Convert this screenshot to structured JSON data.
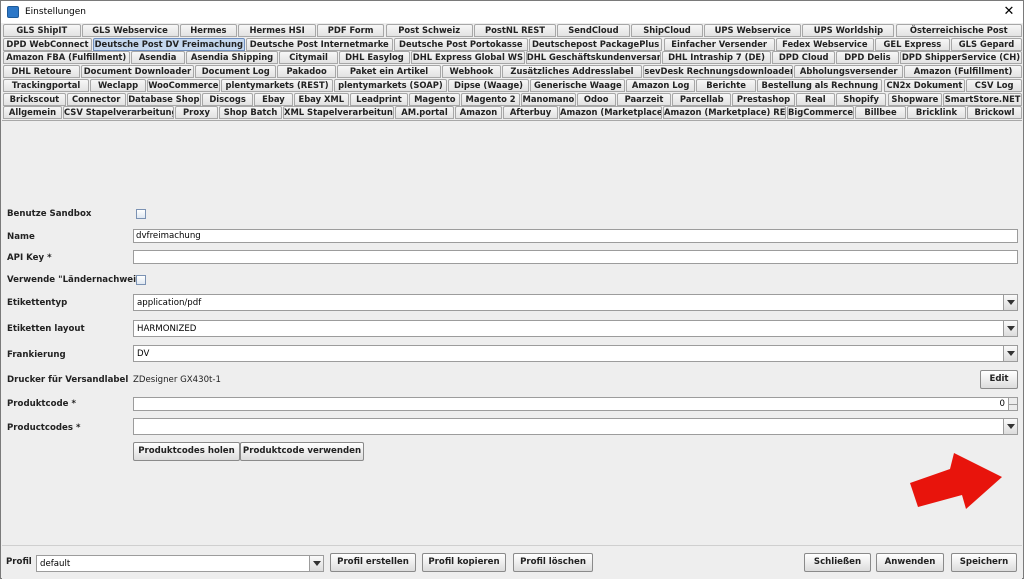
{
  "window": {
    "title": "Einstellungen",
    "close": "✕"
  },
  "tab_rows": [
    [
      "GLS ShipIT",
      "GLS Webservice",
      "Hermes",
      "Hermes HSI",
      "PDF Form",
      "Post Schweiz",
      "PostNL REST",
      "SendCloud",
      "ShipCloud",
      "UPS Webservice",
      "UPS Worldship",
      "Österreichische Post"
    ],
    [
      "DPD WebConnect",
      "Deutsche Post DV Freimachung",
      "Deutsche Post Internetmarke",
      "Deutsche Post Portokasse",
      "Deutschepost PackagePlus",
      "Einfacher Versender",
      "Fedex Webservice",
      "GEL Express",
      "GLS Gepard"
    ],
    [
      "Amazon FBA (Fulfillment)",
      "Asendia",
      "Asendia Shipping",
      "Citymail",
      "DHL Easylog",
      "DHL Express Global WS",
      "DHL Geschäftskundenversand",
      "DHL Intraship 7 (DE)",
      "DPD Cloud",
      "DPD Delis",
      "DPD ShipperService (CH)"
    ],
    [
      "DHL Retoure",
      "Document Downloader",
      "Document Log",
      "Pakadoo",
      "Paket ein Artikel",
      "Webhook",
      "Zusätzliches Addresslabel",
      "sevDesk Rechnungsdownloader",
      "Abholungsversender",
      "Amazon (Fulfillment)"
    ],
    [
      "Trackingportal",
      "Weclapp",
      "WooCommerce",
      "plentymarkets (REST)",
      "plentymarkets (SOAP)",
      "Dipse (Waage)",
      "Generische Waage",
      "Amazon Log",
      "Berichte",
      "Bestellung als Rechnung",
      "CN2x Dokument",
      "CSV Log"
    ],
    [
      "Brickscout",
      "Connector",
      "Database Shop",
      "Discogs",
      "Ebay",
      "Ebay XML",
      "Leadprint",
      "Magento",
      "Magento 2",
      "Manomano",
      "Odoo",
      "Paarzeit",
      "Parcellab",
      "Prestashop",
      "Real",
      "Shopify",
      "Shopware",
      "SmartStore.NET"
    ],
    [
      "Allgemein",
      "CSV Stapelverarbeitung",
      "Proxy",
      "Shop Batch",
      "XML Stapelverarbeitung",
      "AM.portal",
      "Amazon",
      "Afterbuy",
      "Amazon (Marketplace)",
      "Amazon (Marketplace) REST",
      "BigCommerce",
      "Billbee",
      "Bricklink",
      "Brickowl"
    ]
  ],
  "active_tab": "Deutsche Post DV Freimachung",
  "form": {
    "sandbox_label": "Benutze Sandbox",
    "name_label": "Name",
    "name_value": "dvfreimachung",
    "apikey_label": "API Key *",
    "apikey_value": "",
    "laender_label": "Verwende \"Ländernachweis\"",
    "etikettentyp_label": "Etikettentyp",
    "etikettentyp_value": "application/pdf",
    "layout_label": "Etiketten layout",
    "layout_value": "HARMONIZED",
    "frankierung_label": "Frankierung",
    "frankierung_value": "DV",
    "drucker_label": "Drucker für Versandlabel",
    "drucker_value": "ZDesigner GX430t-1",
    "edit_label": "Edit",
    "produktcode_label": "Produktcode *",
    "produktcode_value": "0",
    "productcodes_label": "Productcodes *",
    "productcodes_value": "",
    "holen_label": "Produktcodes holen",
    "verwenden_label": "Produktcode verwenden"
  },
  "bottom": {
    "profil_label": "Profil",
    "profil_value": "default",
    "erstellen": "Profil erstellen",
    "kopieren": "Profil kopieren",
    "loeschen": "Profil löschen",
    "schliessen": "Schließen",
    "anwenden": "Anwenden",
    "speichern": "Speichern"
  },
  "colors": {
    "annotation_arrow": "#e8140c",
    "active_tab": "#c5d8ef"
  }
}
